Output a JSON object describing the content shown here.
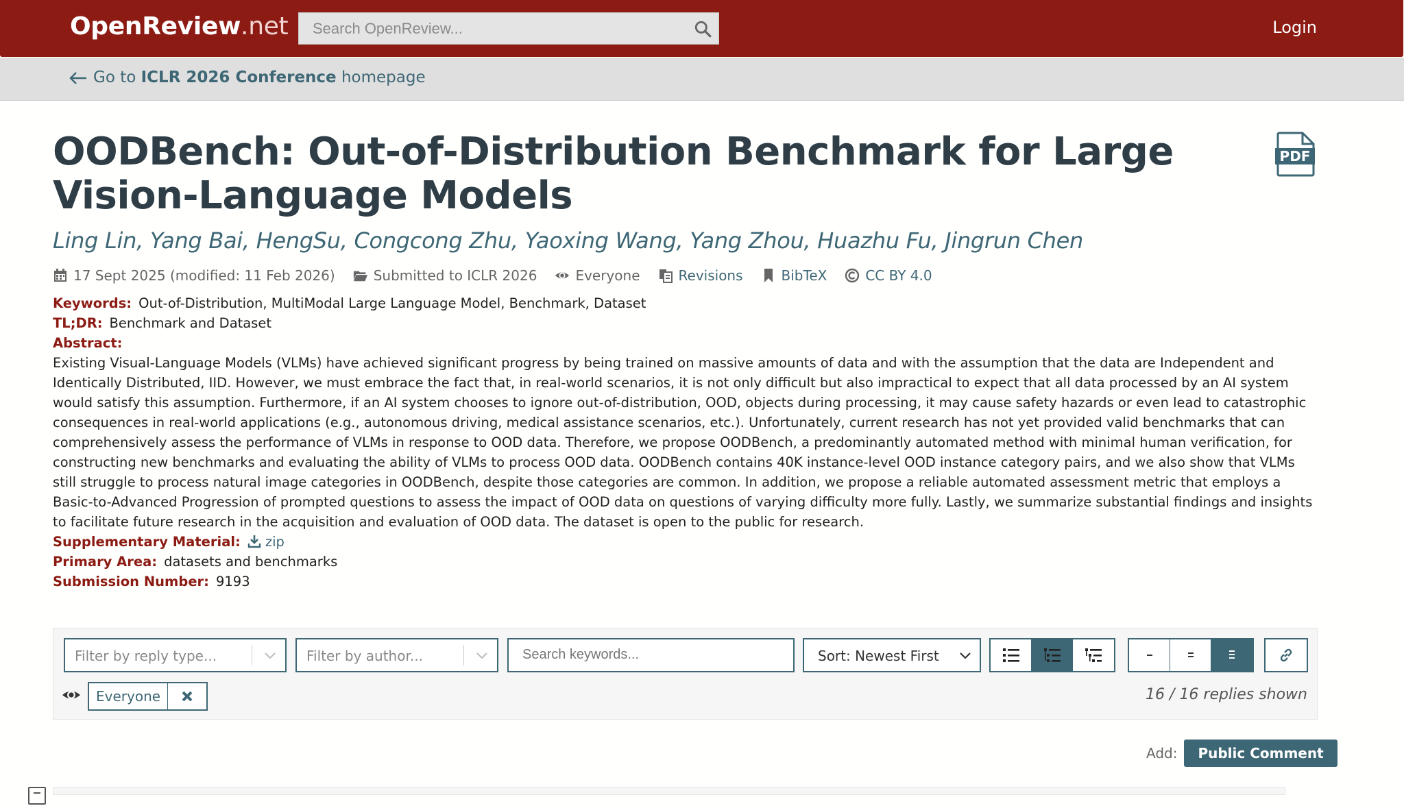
{
  "header": {
    "brand_bold": "OpenReview",
    "brand_suffix": ".net",
    "search_placeholder": "Search OpenReview...",
    "login_label": "Login"
  },
  "subheader": {
    "prefix": "Go to",
    "venue": "ICLR 2026 Conference",
    "suffix": "homepage"
  },
  "paper": {
    "title": "OODBench: Out-of-Distribution Benchmark for Large Vision-Language Models",
    "authors": "Ling Lin, Yang Bai, HengSu, Congcong Zhu, Yaoxing Wang, Yang Zhou, Huazhu Fu, Jingrun Chen",
    "meta": {
      "date": "17 Sept 2025 (modified: 11 Feb 2026)",
      "venue": "Submitted to ICLR 2026",
      "readers": "Everyone",
      "revisions": "Revisions",
      "bibtex": "BibTeX",
      "license": "CC BY 4.0"
    },
    "fields": {
      "keywords_label": "Keywords:",
      "keywords": "Out-of-Distribution, MultiModal Large Language Model, Benchmark, Dataset",
      "tldr_label": "TL;DR:",
      "tldr": "Benchmark and Dataset",
      "abstract_label": "Abstract:",
      "abstract": "Existing Visual-Language Models (VLMs) have achieved significant progress by being trained on massive amounts of data and with the assumption that the data are Independent and Identically Distributed, IID. However, we must embrace the fact that, in real-world scenarios, it is not only difficult but also impractical to expect that all data processed by an AI system would satisfy this assumption. Furthermore, if an AI system chooses to ignore out-of-distribution, OOD, objects during processing, it may cause safety hazards or even lead to catastrophic consequences in real-world applications (e.g., autonomous driving, medical assistance scenarios, etc.). Unfortunately, current research has not yet provided valid benchmarks that can comprehensively assess the performance of VLMs in response to OOD data. Therefore, we propose OODBench, a predominantly automated method with minimal human verification, for constructing new benchmarks and evaluating the ability of VLMs to process OOD data. OODBench contains 40K instance-level OOD instance category pairs, and we also show that VLMs still struggle to process natural image categories in OODBench, despite those categories are common. In addition, we propose a reliable automated assessment metric that employs a Basic-to-Advanced Progression of prompted questions to assess the impact of OOD data on questions of varying difficulty more fully. Lastly, we summarize substantial findings and insights to facilitate future research in the acquisition and evaluation of OOD data. The dataset is open to the public for research.",
      "supplementary_label": "Supplementary Material:",
      "supplementary": "zip",
      "primary_area_label": "Primary Area:",
      "primary_area": "datasets and benchmarks",
      "submission_number_label": "Submission Number:",
      "submission_number": "9193"
    }
  },
  "forum": {
    "filter_reply_type_placeholder": "Filter by reply type...",
    "filter_author_placeholder": "Filter by author...",
    "search_keywords_placeholder": "Search keywords...",
    "sort_selected": "Sort: Newest First",
    "reader_chip": "Everyone",
    "replies_shown": "16 / 16 replies shown",
    "add_label": "Add:",
    "public_comment_button": "Public Comment"
  },
  "colors": {
    "brand_red": "#8c1b13",
    "accent_teal": "#3e6775",
    "title_dark": "#2e3d46"
  }
}
